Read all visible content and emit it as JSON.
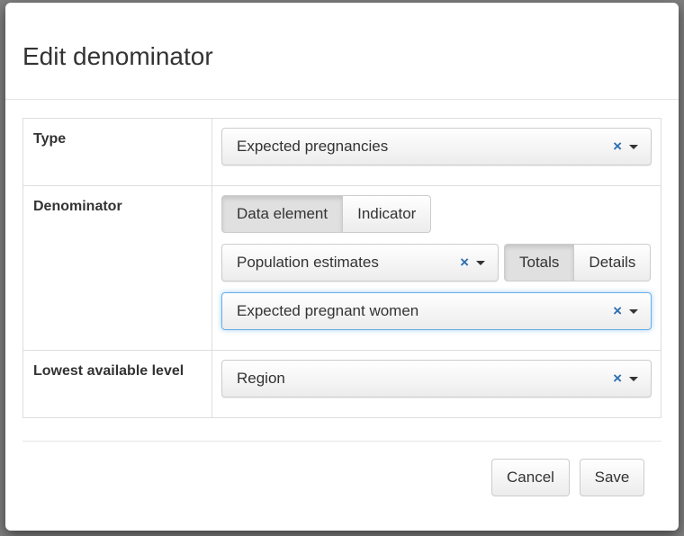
{
  "modal": {
    "title": "Edit denominator"
  },
  "type_row": {
    "label": "Type",
    "value": "Expected pregnancies",
    "clear_icon": "×"
  },
  "denominator_row": {
    "label": "Denominator",
    "source_toggle": {
      "options": [
        "Data element",
        "Indicator"
      ],
      "selected": "Data element"
    },
    "group_select": {
      "value": "Population estimates",
      "clear_icon": "×"
    },
    "detail_toggle": {
      "options": [
        "Totals",
        "Details"
      ],
      "selected": "Totals"
    },
    "element_select": {
      "value": "Expected pregnant women",
      "clear_icon": "×"
    }
  },
  "level_row": {
    "label": "Lowest available level",
    "value": "Region",
    "clear_icon": "×"
  },
  "footer": {
    "cancel_label": "Cancel",
    "save_label": "Save"
  },
  "colors": {
    "accent": "#2f6fb1",
    "focus": "#66afe9"
  }
}
